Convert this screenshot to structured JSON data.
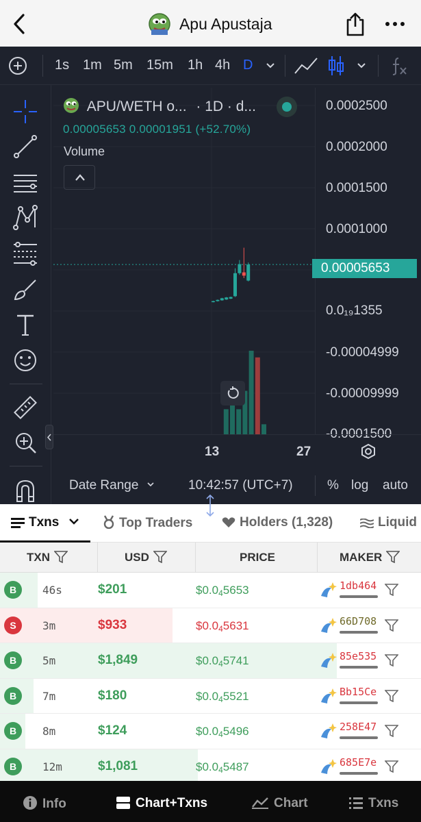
{
  "header": {
    "title": "Apu Apustaja",
    "icons": {
      "back": "chevron-left-icon",
      "share": "share-icon",
      "more": "more-icon",
      "avatar": "pepe-avatar"
    }
  },
  "chart_toolbar": {
    "intervals": [
      "1s",
      "1m",
      "5m",
      "15m",
      "1h",
      "4h",
      "D"
    ],
    "active_interval": "D",
    "icons": [
      "add-icon",
      "dropdown-icon",
      "line-chart-icon",
      "candles-icon",
      "dropdown-icon",
      "fx-icon"
    ]
  },
  "left_tools": [
    "crosshair-icon",
    "trend-line-icon",
    "horizontal-lines-icon",
    "pattern-icon",
    "fib-icon",
    "brush-icon",
    "text-icon",
    "emoji-icon",
    "ruler-icon",
    "zoom-in-icon",
    "magnet-icon"
  ],
  "chart": {
    "symbol": "APU/WETH o...",
    "interval_text": "· 1D · d...",
    "ohlc": "0.00005653  0.00001951 (+52.70%)",
    "volume_label": "Volume",
    "price_label": "0.00005653",
    "y_ticks": [
      "0.0002500",
      "0.0002000",
      "0.0001500",
      "0.0001000",
      "0.0₁₉1355",
      "-0.00004999",
      "-0.00009999",
      "-0.0001500"
    ],
    "x_ticks": [
      "13",
      "27"
    ],
    "date_range": "Date Range",
    "time": "10:42:57 (UTC+7)",
    "options": [
      "%",
      "log",
      "auto"
    ]
  },
  "chart_data": {
    "type": "candlestick",
    "title": "APU/WETH",
    "interval": "1D",
    "last_price": 5.653e-05,
    "change": 1.951e-05,
    "change_pct": "+52.70%",
    "ylim": [
      -0.00015,
      0.00025
    ],
    "x_ticks": [
      "13",
      "27"
    ],
    "candles": [
      {
        "open": 1.1e-05,
        "close": 1.2e-05,
        "high": 1.25e-05,
        "low": 1.05e-05
      },
      {
        "open": 1.2e-05,
        "close": 1.35e-05,
        "high": 1.4e-05,
        "low": 1.15e-05
      },
      {
        "open": 1.3e-05,
        "close": 1.55e-05,
        "high": 1.6e-05,
        "low": 1.25e-05
      },
      {
        "open": 1.4e-05,
        "close": 1.65e-05,
        "high": 1.7e-05,
        "low": 1.35e-05
      },
      {
        "open": 1.5e-05,
        "close": 1.7e-05,
        "high": 1.75e-05,
        "low": 1.45e-05
      },
      {
        "open": 1.8e-05,
        "close": 4.6e-05,
        "high": 5.2e-05,
        "low": 1.7e-05
      },
      {
        "open": 4.6e-05,
        "close": 5.7e-05,
        "high": 6.2e-05,
        "low": 4.4e-05
      },
      {
        "open": 4.7e-05,
        "close": 4.3e-05,
        "high": 7.7e-05,
        "low": 4e-05
      },
      {
        "open": 3.7e-05,
        "close": 5.65e-05,
        "high": 5.9e-05,
        "low": 3.6e-05
      }
    ],
    "volume": [
      {
        "value": 0.0,
        "up": true
      },
      {
        "value": 0.0,
        "up": true
      },
      {
        "value": 0.0,
        "up": true
      },
      {
        "value": 0.0,
        "up": true
      },
      {
        "value": 0.3,
        "up": true
      },
      {
        "value": 0.62,
        "up": true
      },
      {
        "value": 0.3,
        "up": true
      },
      {
        "value": 0.52,
        "up": true
      },
      {
        "value": 1.0,
        "up": true
      },
      {
        "value": 0.92,
        "up": false
      },
      {
        "value": 0.12,
        "up": true
      }
    ]
  },
  "tabs": [
    {
      "label": "Txns",
      "icon": "list-icon",
      "active": true
    },
    {
      "label": "Top Traders",
      "icon": "medal-icon",
      "active": false
    },
    {
      "label": "Holders (1,328)",
      "icon": "heart-icon",
      "active": false
    },
    {
      "label": "Liquid",
      "icon": "liquidity-icon",
      "active": false
    }
  ],
  "table": {
    "columns": [
      "TXN",
      "USD",
      "PRICE",
      "MAKER"
    ],
    "rows": [
      {
        "type": "B",
        "age": "46s",
        "usd": "$201",
        "price_pre": "$0.0",
        "price_sub": "4",
        "price_post": "5653",
        "maker": "1db464",
        "usd_share": 0.09,
        "maker_icon": "sparkle-fish-icon"
      },
      {
        "type": "S",
        "age": "3m",
        "usd": "$933",
        "price_pre": "$0.0",
        "price_sub": "4",
        "price_post": "5631",
        "maker": "66D708",
        "usd_share": 0.41,
        "maker_icon": "sparkle-shrimp-icon"
      },
      {
        "type": "B",
        "age": "5m",
        "usd": "$1,849",
        "price_pre": "$0.0",
        "price_sub": "4",
        "price_post": "5741",
        "maker": "85e535",
        "usd_share": 0.8,
        "maker_icon": "whale-icon"
      },
      {
        "type": "B",
        "age": "7m",
        "usd": "$180",
        "price_pre": "$0.0",
        "price_sub": "4",
        "price_post": "5521",
        "maker": "Bb15Ce",
        "usd_share": 0.08,
        "maker_icon": "sparkle-fish-icon"
      },
      {
        "type": "B",
        "age": "8m",
        "usd": "$124",
        "price_pre": "$0.0",
        "price_sub": "4",
        "price_post": "5496",
        "maker": "258E47",
        "usd_share": 0.06,
        "maker_icon": "fish-icon"
      },
      {
        "type": "B",
        "age": "12m",
        "usd": "$1,081",
        "price_pre": "$0.0",
        "price_sub": "4",
        "price_post": "5487",
        "maker": "685E7e",
        "usd_share": 0.47,
        "maker_icon": "sparkle-dolphin-icon"
      }
    ]
  },
  "bottom_nav": [
    {
      "label": "Info",
      "icon": "info-icon",
      "active": false
    },
    {
      "label": "Chart+Txns",
      "icon": "chart-txns-icon",
      "active": true
    },
    {
      "label": "Chart",
      "icon": "chart-icon",
      "active": false
    },
    {
      "label": "Txns",
      "icon": "list-icon",
      "active": false
    }
  ],
  "colors": {
    "up": "#26a69a",
    "down": "#ef5350",
    "buy_text": "#3e9d5b",
    "sell_text": "#d9363e",
    "chart_bg": "#1e222d",
    "accent": "#2962ff"
  }
}
